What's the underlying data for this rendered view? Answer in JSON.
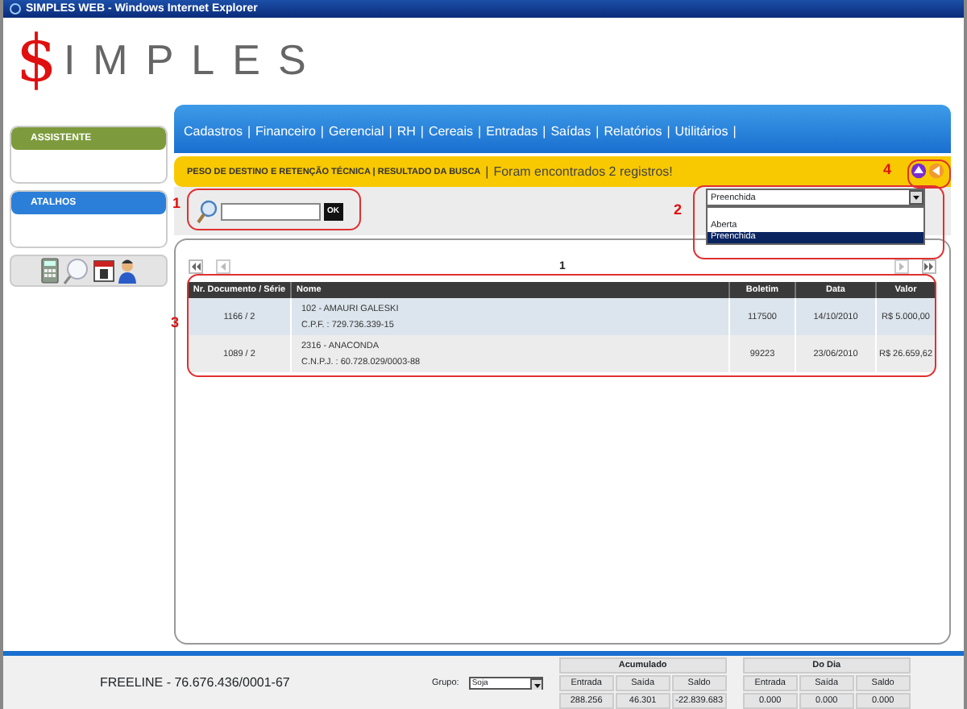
{
  "window": {
    "title": "SIMPLES WEB - Windows Internet Explorer"
  },
  "logo": {
    "symbol": "$",
    "text": "IMPLES"
  },
  "sidebar": {
    "panels": [
      {
        "title": "ASSISTENTE",
        "color": "#7d9b3c"
      },
      {
        "title": "ATALHOS",
        "color": "#2b7fd9"
      }
    ]
  },
  "menu": {
    "items": [
      "Cadastros",
      "Financeiro",
      "Gerencial",
      "RH",
      "Cereais",
      "Entradas",
      "Saídas",
      "Relatórios",
      "Utilitários"
    ],
    "separator": "|"
  },
  "breadcrumb": {
    "path": "PESO DE DESTINO E RETENÇÃO TÉCNICA | RESULTADO DA BUSCA",
    "separator": "|",
    "message": "Foram encontrados 2 registros!"
  },
  "search": {
    "button": "OK"
  },
  "filter": {
    "value": "Preenchida",
    "options": [
      {
        "label": "Aberta",
        "selected": false
      },
      {
        "label": "Preenchida",
        "selected": true
      }
    ]
  },
  "pager": {
    "page": "1"
  },
  "table": {
    "columns": [
      "Nr. Documento / Série",
      "Nome",
      "Boletim",
      "Data",
      "Valor"
    ],
    "rows": [
      {
        "document": "1166 / 2",
        "name": "102 - AMAURI GALESKI",
        "tax_id": "C.P.F. : 729.736.339-15",
        "boletim": "117500",
        "date": "14/10/2010",
        "value": "R$ 5.000,00"
      },
      {
        "document": "1089 / 2",
        "name": "2316 - ANACONDA",
        "tax_id": "C.N.P.J. : 60.728.029/0003-88",
        "boletim": "99223",
        "date": "23/06/2010",
        "value": "R$ 26.659,62"
      }
    ]
  },
  "annotations": {
    "search": "1",
    "filter": "2",
    "table": "3",
    "actions": "4"
  },
  "footer": {
    "company": "FREELINE - 76.676.436/0001-67",
    "group_label": "Grupo:",
    "group_value": "Soja",
    "totals": [
      {
        "title": "Acumulado",
        "columns": [
          "Entrada",
          "Saída",
          "Saldo"
        ],
        "values": [
          "288.256",
          "46.301",
          "-22.839.683"
        ]
      },
      {
        "title": "Do Dia",
        "columns": [
          "Entrada",
          "Saída",
          "Saldo"
        ],
        "values": [
          "0.000",
          "0.000",
          "0.000"
        ]
      }
    ]
  }
}
